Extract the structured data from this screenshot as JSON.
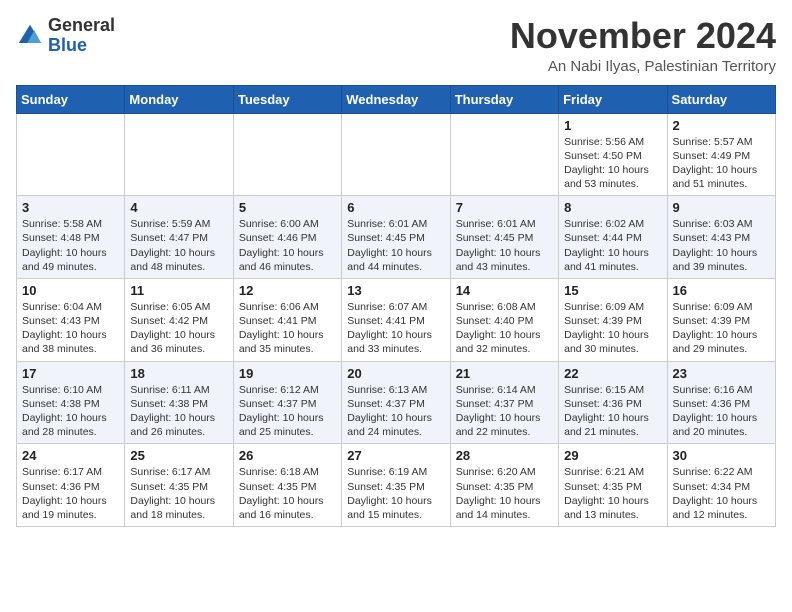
{
  "logo": {
    "general": "General",
    "blue": "Blue"
  },
  "header": {
    "month": "November 2024",
    "location": "An Nabi Ilyas, Palestinian Territory"
  },
  "weekdays": [
    "Sunday",
    "Monday",
    "Tuesday",
    "Wednesday",
    "Thursday",
    "Friday",
    "Saturday"
  ],
  "weeks": [
    [
      {
        "day": "",
        "info": ""
      },
      {
        "day": "",
        "info": ""
      },
      {
        "day": "",
        "info": ""
      },
      {
        "day": "",
        "info": ""
      },
      {
        "day": "",
        "info": ""
      },
      {
        "day": "1",
        "info": "Sunrise: 5:56 AM\nSunset: 4:50 PM\nDaylight: 10 hours\nand 53 minutes."
      },
      {
        "day": "2",
        "info": "Sunrise: 5:57 AM\nSunset: 4:49 PM\nDaylight: 10 hours\nand 51 minutes."
      }
    ],
    [
      {
        "day": "3",
        "info": "Sunrise: 5:58 AM\nSunset: 4:48 PM\nDaylight: 10 hours\nand 49 minutes."
      },
      {
        "day": "4",
        "info": "Sunrise: 5:59 AM\nSunset: 4:47 PM\nDaylight: 10 hours\nand 48 minutes."
      },
      {
        "day": "5",
        "info": "Sunrise: 6:00 AM\nSunset: 4:46 PM\nDaylight: 10 hours\nand 46 minutes."
      },
      {
        "day": "6",
        "info": "Sunrise: 6:01 AM\nSunset: 4:45 PM\nDaylight: 10 hours\nand 44 minutes."
      },
      {
        "day": "7",
        "info": "Sunrise: 6:01 AM\nSunset: 4:45 PM\nDaylight: 10 hours\nand 43 minutes."
      },
      {
        "day": "8",
        "info": "Sunrise: 6:02 AM\nSunset: 4:44 PM\nDaylight: 10 hours\nand 41 minutes."
      },
      {
        "day": "9",
        "info": "Sunrise: 6:03 AM\nSunset: 4:43 PM\nDaylight: 10 hours\nand 39 minutes."
      }
    ],
    [
      {
        "day": "10",
        "info": "Sunrise: 6:04 AM\nSunset: 4:43 PM\nDaylight: 10 hours\nand 38 minutes."
      },
      {
        "day": "11",
        "info": "Sunrise: 6:05 AM\nSunset: 4:42 PM\nDaylight: 10 hours\nand 36 minutes."
      },
      {
        "day": "12",
        "info": "Sunrise: 6:06 AM\nSunset: 4:41 PM\nDaylight: 10 hours\nand 35 minutes."
      },
      {
        "day": "13",
        "info": "Sunrise: 6:07 AM\nSunset: 4:41 PM\nDaylight: 10 hours\nand 33 minutes."
      },
      {
        "day": "14",
        "info": "Sunrise: 6:08 AM\nSunset: 4:40 PM\nDaylight: 10 hours\nand 32 minutes."
      },
      {
        "day": "15",
        "info": "Sunrise: 6:09 AM\nSunset: 4:39 PM\nDaylight: 10 hours\nand 30 minutes."
      },
      {
        "day": "16",
        "info": "Sunrise: 6:09 AM\nSunset: 4:39 PM\nDaylight: 10 hours\nand 29 minutes."
      }
    ],
    [
      {
        "day": "17",
        "info": "Sunrise: 6:10 AM\nSunset: 4:38 PM\nDaylight: 10 hours\nand 28 minutes."
      },
      {
        "day": "18",
        "info": "Sunrise: 6:11 AM\nSunset: 4:38 PM\nDaylight: 10 hours\nand 26 minutes."
      },
      {
        "day": "19",
        "info": "Sunrise: 6:12 AM\nSunset: 4:37 PM\nDaylight: 10 hours\nand 25 minutes."
      },
      {
        "day": "20",
        "info": "Sunrise: 6:13 AM\nSunset: 4:37 PM\nDaylight: 10 hours\nand 24 minutes."
      },
      {
        "day": "21",
        "info": "Sunrise: 6:14 AM\nSunset: 4:37 PM\nDaylight: 10 hours\nand 22 minutes."
      },
      {
        "day": "22",
        "info": "Sunrise: 6:15 AM\nSunset: 4:36 PM\nDaylight: 10 hours\nand 21 minutes."
      },
      {
        "day": "23",
        "info": "Sunrise: 6:16 AM\nSunset: 4:36 PM\nDaylight: 10 hours\nand 20 minutes."
      }
    ],
    [
      {
        "day": "24",
        "info": "Sunrise: 6:17 AM\nSunset: 4:36 PM\nDaylight: 10 hours\nand 19 minutes."
      },
      {
        "day": "25",
        "info": "Sunrise: 6:17 AM\nSunset: 4:35 PM\nDaylight: 10 hours\nand 18 minutes."
      },
      {
        "day": "26",
        "info": "Sunrise: 6:18 AM\nSunset: 4:35 PM\nDaylight: 10 hours\nand 16 minutes."
      },
      {
        "day": "27",
        "info": "Sunrise: 6:19 AM\nSunset: 4:35 PM\nDaylight: 10 hours\nand 15 minutes."
      },
      {
        "day": "28",
        "info": "Sunrise: 6:20 AM\nSunset: 4:35 PM\nDaylight: 10 hours\nand 14 minutes."
      },
      {
        "day": "29",
        "info": "Sunrise: 6:21 AM\nSunset: 4:35 PM\nDaylight: 10 hours\nand 13 minutes."
      },
      {
        "day": "30",
        "info": "Sunrise: 6:22 AM\nSunset: 4:34 PM\nDaylight: 10 hours\nand 12 minutes."
      }
    ]
  ]
}
